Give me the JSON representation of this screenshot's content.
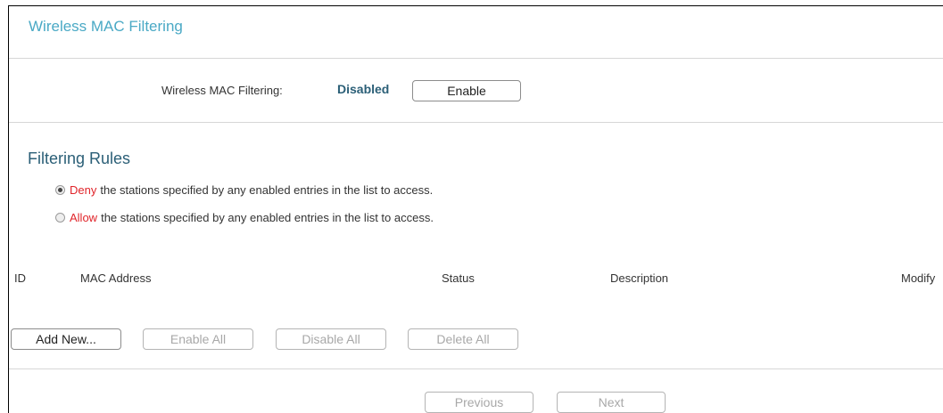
{
  "page": {
    "title": "Wireless MAC Filtering"
  },
  "filtering": {
    "label": "Wireless MAC Filtering:",
    "status": "Disabled",
    "enable_button": "Enable"
  },
  "rules": {
    "title": "Filtering Rules",
    "options": [
      {
        "keyword": "Deny",
        "text": "the stations specified by any enabled entries in the list to access.",
        "selected": true
      },
      {
        "keyword": "Allow",
        "text": "the stations specified by any enabled entries in the list to access.",
        "selected": false
      }
    ]
  },
  "table": {
    "headers": {
      "id": "ID",
      "mac": "MAC Address",
      "status": "Status",
      "description": "Description",
      "modify": "Modify"
    },
    "rows": []
  },
  "actions": {
    "add_new": "Add New...",
    "enable_all": "Enable All",
    "disable_all": "Disable All",
    "delete_all": "Delete All"
  },
  "pagination": {
    "previous": "Previous",
    "next": "Next"
  },
  "colors": {
    "title": "#4aa9c5",
    "heading": "#2b5f77",
    "keyword": "#e0242a",
    "divider": "#d6d6d6"
  }
}
